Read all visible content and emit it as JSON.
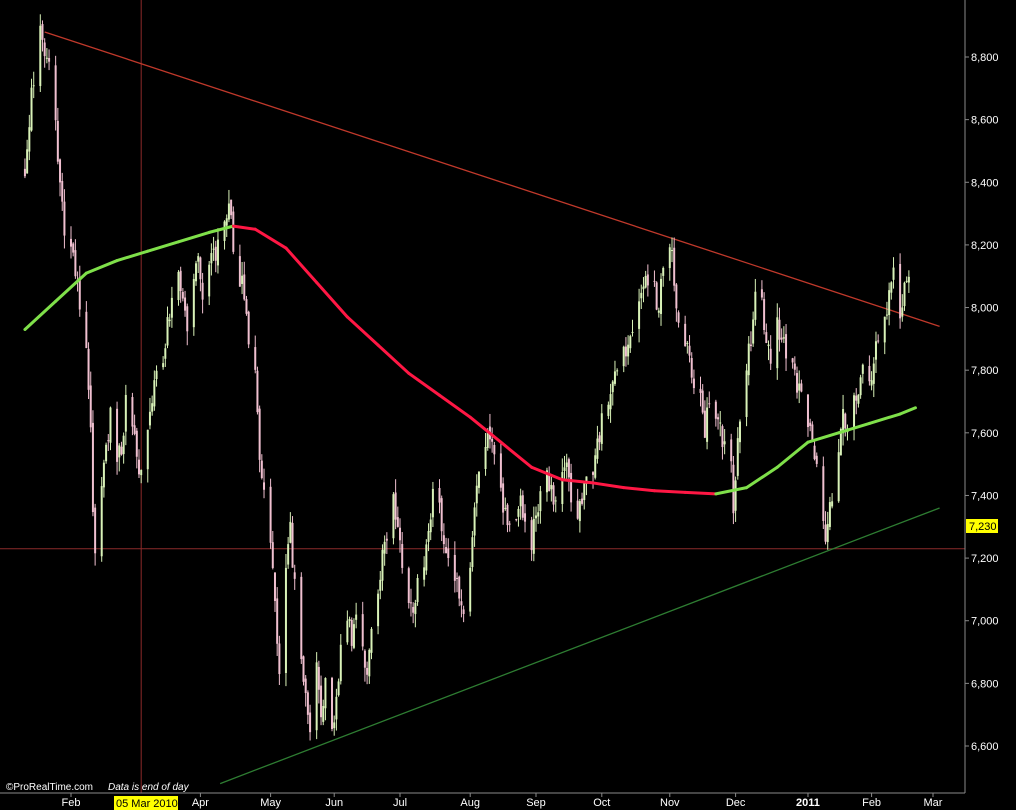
{
  "chart_data": {
    "type": "candlestick",
    "y_range": [
      6480,
      9000
    ],
    "y_ticks": [
      "8,800",
      "8,600",
      "8,400",
      "8,200",
      "8,000",
      "7,800",
      "7,600",
      "7,400",
      "7,200",
      "7,000",
      "6,800",
      "6,600"
    ],
    "y_tick_values": [
      8800,
      8600,
      8400,
      8200,
      8000,
      7800,
      7600,
      7400,
      7200,
      7000,
      6800,
      6600
    ],
    "x_labels": [
      "Feb",
      "Apr",
      "May",
      "Jun",
      "Jul",
      "Aug",
      "Sep",
      "Oct",
      "Nov",
      "Dec",
      "2011",
      "Feb",
      "Mar"
    ],
    "x_label_dates": [
      "2010-02-01",
      "2010-04-01",
      "2010-05-03",
      "2010-06-01",
      "2010-07-01",
      "2010-08-02",
      "2010-09-01",
      "2010-10-01",
      "2010-11-01",
      "2010-12-01",
      "2011-01-03",
      "2011-02-01",
      "2011-03-01"
    ],
    "date_range": [
      "2010-01-11",
      "2011-03-04"
    ],
    "crosshair": {
      "date_label": "05 Mar 2010",
      "date": "2010-03-05",
      "value_label": "7,230",
      "value": 7230
    },
    "ohlc_path": [
      [
        "2010-01-11",
        8450
      ],
      [
        "2010-01-12",
        8500
      ],
      [
        "2010-01-14",
        8700
      ],
      [
        "2010-01-18",
        8870
      ],
      [
        "2010-01-20",
        8780
      ],
      [
        "2010-01-22",
        8760
      ],
      [
        "2010-01-25",
        8600
      ],
      [
        "2010-01-27",
        8400
      ],
      [
        "2010-01-29",
        8250
      ],
      [
        "2010-02-01",
        8200
      ],
      [
        "2010-02-03",
        8100
      ],
      [
        "2010-02-05",
        8000
      ],
      [
        "2010-02-08",
        7850
      ],
      [
        "2010-02-10",
        7600
      ],
      [
        "2010-02-11",
        7380
      ],
      [
        "2010-02-12",
        7250
      ],
      [
        "2010-02-15",
        7450
      ],
      [
        "2010-02-17",
        7550
      ],
      [
        "2010-02-19",
        7650
      ],
      [
        "2010-02-22",
        7500
      ],
      [
        "2010-02-24",
        7550
      ],
      [
        "2010-02-26",
        7700
      ],
      [
        "2010-03-01",
        7600
      ],
      [
        "2010-03-03",
        7550
      ],
      [
        "2010-03-05",
        7450
      ],
      [
        "2010-03-08",
        7600
      ],
      [
        "2010-03-10",
        7700
      ],
      [
        "2010-03-12",
        7780
      ],
      [
        "2010-03-15",
        7850
      ],
      [
        "2010-03-17",
        7950
      ],
      [
        "2010-03-19",
        8000
      ],
      [
        "2010-03-22",
        8100
      ],
      [
        "2010-03-24",
        8050
      ],
      [
        "2010-03-26",
        7950
      ],
      [
        "2010-03-29",
        8100
      ],
      [
        "2010-03-31",
        8150
      ],
      [
        "2010-04-02",
        8050
      ],
      [
        "2010-04-06",
        8200
      ],
      [
        "2010-04-08",
        8150
      ],
      [
        "2010-04-12",
        8300
      ],
      [
        "2010-04-14",
        8330
      ],
      [
        "2010-04-16",
        8200
      ],
      [
        "2010-04-19",
        8100
      ],
      [
        "2010-04-21",
        8050
      ],
      [
        "2010-04-23",
        7900
      ],
      [
        "2010-04-26",
        7800
      ],
      [
        "2010-04-28",
        7500
      ],
      [
        "2010-04-30",
        7400
      ],
      [
        "2010-05-03",
        7250
      ],
      [
        "2010-05-05",
        7050
      ],
      [
        "2010-05-07",
        6850
      ],
      [
        "2010-05-10",
        7200
      ],
      [
        "2010-05-12",
        7300
      ],
      [
        "2010-05-14",
        7100
      ],
      [
        "2010-05-17",
        6900
      ],
      [
        "2010-05-19",
        6750
      ],
      [
        "2010-05-21",
        6620
      ],
      [
        "2010-05-24",
        6850
      ],
      [
        "2010-05-26",
        6700
      ],
      [
        "2010-05-28",
        6800
      ],
      [
        "2010-05-31",
        6650
      ],
      [
        "2010-06-02",
        6750
      ],
      [
        "2010-06-04",
        6900
      ],
      [
        "2010-06-07",
        7000
      ],
      [
        "2010-06-09",
        6950
      ],
      [
        "2010-06-11",
        7000
      ],
      [
        "2010-06-14",
        6900
      ],
      [
        "2010-06-16",
        6850
      ],
      [
        "2010-06-18",
        6950
      ],
      [
        "2010-06-21",
        7100
      ],
      [
        "2010-06-23",
        7200
      ],
      [
        "2010-06-25",
        7250
      ],
      [
        "2010-06-28",
        7400
      ],
      [
        "2010-06-30",
        7300
      ],
      [
        "2010-07-02",
        7150
      ],
      [
        "2010-07-05",
        7050
      ],
      [
        "2010-07-07",
        7000
      ],
      [
        "2010-07-09",
        7150
      ],
      [
        "2010-07-12",
        7200
      ],
      [
        "2010-07-14",
        7300
      ],
      [
        "2010-07-16",
        7400
      ],
      [
        "2010-07-19",
        7350
      ],
      [
        "2010-07-21",
        7250
      ],
      [
        "2010-07-23",
        7200
      ],
      [
        "2010-07-26",
        7150
      ],
      [
        "2010-07-28",
        7100
      ],
      [
        "2010-07-30",
        7050
      ],
      [
        "2010-08-02",
        7200
      ],
      [
        "2010-08-04",
        7350
      ],
      [
        "2010-08-06",
        7500
      ],
      [
        "2010-08-09",
        7550
      ],
      [
        "2010-08-11",
        7600
      ],
      [
        "2010-08-13",
        7550
      ],
      [
        "2010-08-16",
        7400
      ],
      [
        "2010-08-18",
        7350
      ],
      [
        "2010-08-20",
        7300
      ],
      [
        "2010-08-23",
        7350
      ],
      [
        "2010-08-25",
        7400
      ],
      [
        "2010-08-27",
        7300
      ],
      [
        "2010-08-30",
        7250
      ],
      [
        "2010-09-01",
        7350
      ],
      [
        "2010-09-03",
        7400
      ],
      [
        "2010-09-06",
        7450
      ],
      [
        "2010-09-08",
        7400
      ],
      [
        "2010-09-10",
        7380
      ],
      [
        "2010-09-13",
        7450
      ],
      [
        "2010-09-15",
        7500
      ],
      [
        "2010-09-17",
        7400
      ],
      [
        "2010-09-20",
        7350
      ],
      [
        "2010-09-22",
        7380
      ],
      [
        "2010-09-24",
        7450
      ],
      [
        "2010-09-27",
        7500
      ],
      [
        "2010-09-29",
        7550
      ],
      [
        "2010-10-01",
        7650
      ],
      [
        "2010-10-04",
        7700
      ],
      [
        "2010-10-06",
        7750
      ],
      [
        "2010-10-08",
        7800
      ],
      [
        "2010-10-11",
        7850
      ],
      [
        "2010-10-13",
        7900
      ],
      [
        "2010-10-15",
        7950
      ],
      [
        "2010-10-18",
        8000
      ],
      [
        "2010-10-20",
        8050
      ],
      [
        "2010-10-22",
        8100
      ],
      [
        "2010-10-25",
        8050
      ],
      [
        "2010-10-27",
        8000
      ],
      [
        "2010-10-29",
        8150
      ],
      [
        "2010-11-01",
        8200
      ],
      [
        "2010-11-03",
        8100
      ],
      [
        "2010-11-05",
        7950
      ],
      [
        "2010-11-08",
        7900
      ],
      [
        "2010-11-10",
        7850
      ],
      [
        "2010-11-12",
        7750
      ],
      [
        "2010-11-15",
        7700
      ],
      [
        "2010-11-17",
        7600
      ],
      [
        "2010-11-19",
        7700
      ],
      [
        "2010-11-22",
        7650
      ],
      [
        "2010-11-24",
        7600
      ],
      [
        "2010-11-26",
        7550
      ],
      [
        "2010-11-29",
        7500
      ],
      [
        "2010-11-30",
        7350
      ],
      [
        "2010-12-02",
        7600
      ],
      [
        "2010-12-06",
        7800
      ],
      [
        "2010-12-08",
        7900
      ],
      [
        "2010-12-10",
        8050
      ],
      [
        "2010-12-13",
        8000
      ],
      [
        "2010-12-15",
        7900
      ],
      [
        "2010-12-17",
        7850
      ],
      [
        "2010-12-20",
        7950
      ],
      [
        "2010-12-22",
        7900
      ],
      [
        "2010-12-24",
        7850
      ],
      [
        "2010-12-27",
        7800
      ],
      [
        "2010-12-29",
        7750
      ],
      [
        "2010-12-31",
        7700
      ],
      [
        "2011-01-03",
        7650
      ],
      [
        "2011-01-05",
        7600
      ],
      [
        "2011-01-07",
        7500
      ],
      [
        "2011-01-10",
        7300
      ],
      [
        "2011-01-11",
        7220
      ],
      [
        "2011-01-13",
        7350
      ],
      [
        "2011-01-17",
        7550
      ],
      [
        "2011-01-19",
        7650
      ],
      [
        "2011-01-21",
        7600
      ],
      [
        "2011-01-24",
        7700
      ],
      [
        "2011-01-26",
        7750
      ],
      [
        "2011-01-28",
        7800
      ],
      [
        "2011-01-31",
        7750
      ],
      [
        "2011-02-02",
        7850
      ],
      [
        "2011-02-04",
        7900
      ],
      [
        "2011-02-07",
        7950
      ],
      [
        "2011-02-09",
        8050
      ],
      [
        "2011-02-11",
        8100
      ],
      [
        "2011-02-14",
        7950
      ],
      [
        "2011-02-16",
        8050
      ],
      [
        "2011-02-18",
        8100
      ],
      [
        "2011-02-21",
        8150
      ]
    ],
    "moving_average": {
      "start_date": "2010-01-11",
      "points": [
        [
          "2010-01-11",
          7930
        ],
        [
          "2010-01-25",
          8020
        ],
        [
          "2010-02-08",
          8110
        ],
        [
          "2010-02-22",
          8150
        ],
        [
          "2010-03-08",
          8180
        ],
        [
          "2010-03-22",
          8210
        ],
        [
          "2010-04-05",
          8240
        ],
        [
          "2010-04-16",
          8260
        ],
        [
          "2010-04-26",
          8250
        ],
        [
          "2010-05-10",
          8190
        ],
        [
          "2010-05-24",
          8080
        ],
        [
          "2010-06-07",
          7970
        ],
        [
          "2010-06-21",
          7880
        ],
        [
          "2010-07-05",
          7790
        ],
        [
          "2010-07-19",
          7720
        ],
        [
          "2010-08-02",
          7650
        ],
        [
          "2010-08-16",
          7570
        ],
        [
          "2010-08-30",
          7490
        ],
        [
          "2010-09-13",
          7450
        ],
        [
          "2010-09-27",
          7440
        ],
        [
          "2010-10-11",
          7425
        ],
        [
          "2010-10-25",
          7415
        ],
        [
          "2010-11-08",
          7410
        ],
        [
          "2010-11-22",
          7405
        ],
        [
          "2010-12-06",
          7425
        ],
        [
          "2010-12-20",
          7490
        ],
        [
          "2011-01-03",
          7570
        ],
        [
          "2011-01-17",
          7600
        ],
        [
          "2011-01-31",
          7630
        ],
        [
          "2011-02-14",
          7660
        ],
        [
          "2011-02-21",
          7680
        ]
      ],
      "rising_color": "#7fe04a",
      "falling_color": "#ff1744"
    },
    "resistance_line": {
      "from": [
        "2010-01-20",
        8880
      ],
      "to": [
        "2011-03-04",
        7940
      ],
      "color": "#c0392b"
    },
    "support_line": {
      "from": [
        "2010-04-10",
        6480
      ],
      "to": [
        "2011-03-04",
        7360
      ],
      "color": "#2e7d32"
    }
  },
  "footer": {
    "credit_text": "©ProRealTime.com",
    "note_text": "Data is end of day"
  },
  "colors": {
    "background": "#000000",
    "up_candle": "#d9f2b8",
    "down_candle": "#f0c0d0",
    "crosshair": "#8b2a2a",
    "cursor_label_bg": "#ffff00",
    "axis": "#8a8a8a"
  }
}
